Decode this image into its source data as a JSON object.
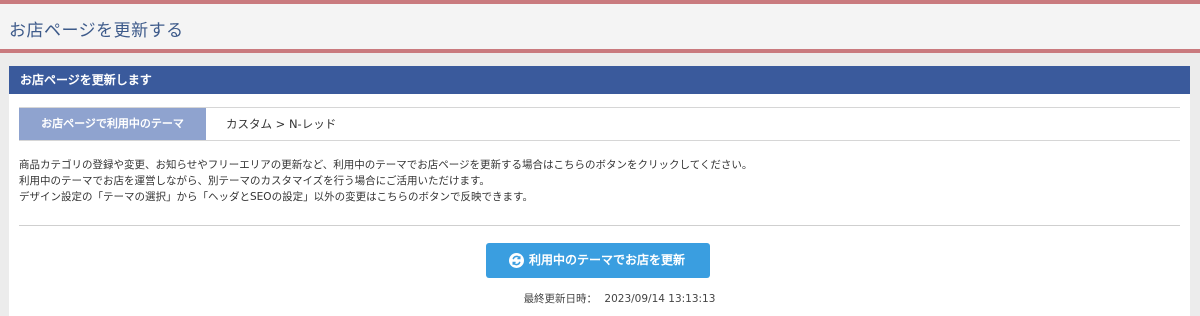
{
  "header": {
    "title": "お店ページを更新する"
  },
  "panel": {
    "heading": "お店ページを更新します",
    "theme_label": "お店ページで利用中のテーマ",
    "theme_value": "カスタム > N-レッド",
    "description": [
      "商品カテゴリの登録や変更、お知らせやフリーエリアの更新など、利用中のテーマでお店ページを更新する場合はこちらのボタンをクリックしてください。",
      "利用中のテーマでお店を運営しながら、別テーマのカスタマイズを行う場合にご活用いただけます。",
      "デザイン設定の「テーマの選択」から「ヘッダとSEOの設定」以外の変更はこちらのボタンで反映できます。"
    ],
    "button_label": "利用中のテーマでお店を更新",
    "button_icon": "refresh-icon",
    "last_updated_label": "最終更新日時：",
    "last_updated_value": "2023/09/14 13:13:13"
  },
  "colors": {
    "header_border": "#c97a7e",
    "header_title": "#3d5a8a",
    "panel_head_bg": "#3a5a9c",
    "theme_label_bg": "#8fa3cf",
    "button_bg": "#3a9ee0"
  }
}
